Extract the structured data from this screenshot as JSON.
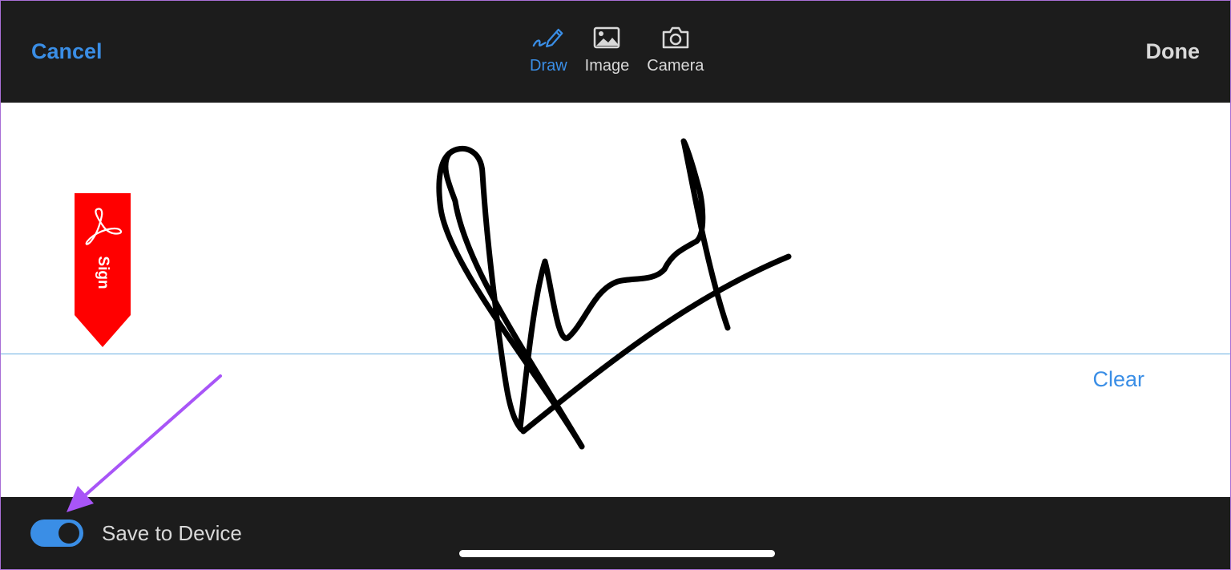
{
  "header": {
    "cancel_label": "Cancel",
    "done_label": "Done",
    "modes": [
      {
        "label": "Draw",
        "icon": "pen-icon",
        "active": true
      },
      {
        "label": "Image",
        "icon": "image-icon",
        "active": false
      },
      {
        "label": "Camera",
        "icon": "camera-icon",
        "active": false
      }
    ]
  },
  "canvas": {
    "sign_badge_label": "Sign",
    "clear_label": "Clear"
  },
  "footer": {
    "save_label": "Save to Device",
    "save_enabled": true
  },
  "colors": {
    "accent": "#3a8ee6",
    "bar_background": "#1c1c1c",
    "sign_badge": "#ff0000",
    "annotation_arrow": "#a855f7"
  }
}
